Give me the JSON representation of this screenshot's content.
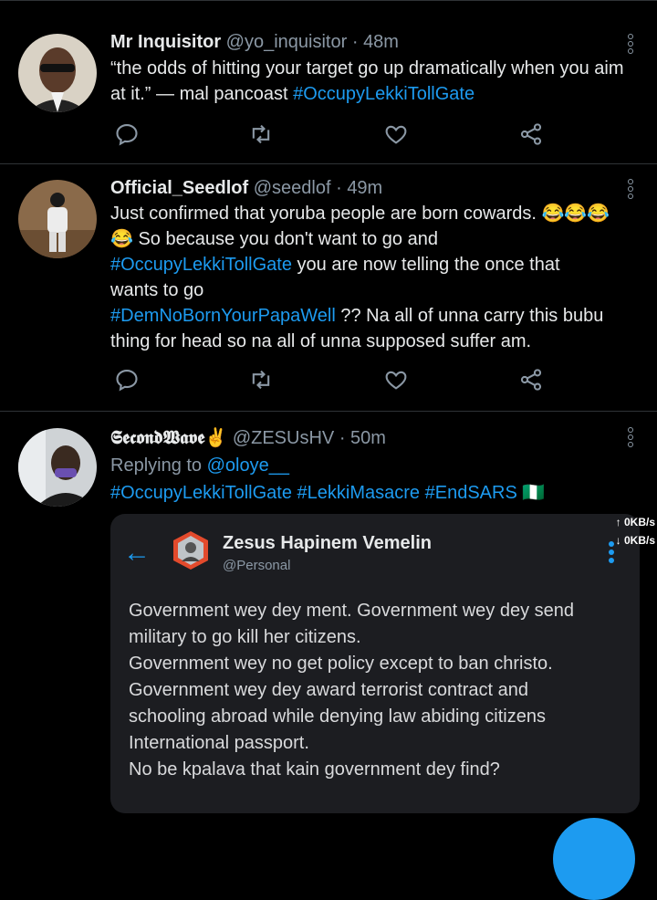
{
  "tweets": [
    {
      "name": "Mr Inquisitor",
      "handle": "@yo_inquisitor",
      "separator": "·",
      "time": "48m",
      "text_parts": [
        "“the odds of hitting your target go up dramatically when you aim at it.” — mal pancoast "
      ],
      "hashtag": "#OccupyLekkiTollGate"
    },
    {
      "name": "Official_Seedlof",
      "handle": "@seedlof",
      "separator": "·",
      "time": "49m",
      "line1": "Just confirmed that yoruba people are born cowards. 😂😂😂",
      "line2": "😂 So because you don't want to go and",
      "hashtag1": "#OccupyLekkiTollGate",
      "line3_rest": " you are now telling the once that",
      "line4": "wants to go",
      "hashtag2": "#DemNoBornYourPapaWell",
      "line5_rest": " ?? Na all of unna carry this bubu",
      "line6": "thing for head so na all of unna supposed suffer am."
    },
    {
      "name": "𝕾𝖊𝖈𝖔𝖓𝖉𝖂𝖆𝖛𝖊✌",
      "handle": "@ZESUsHV",
      "separator": "·",
      "time": "50m",
      "replying_label": "Replying to ",
      "replying_to": "@oloye__",
      "hashtags": [
        "#OccupyLekkiTollGate",
        "#LekkiMasacre",
        "#EndSARS"
      ],
      "hashtag_suffix": "🇳🇬"
    }
  ],
  "quoted": {
    "name": "Zesus Hapinem Vemelin",
    "handle": "@Personal",
    "speed_up": "↑ 0KB/s",
    "speed_down": "↓ 0KB/s",
    "lines": [
      "Government wey dey ment. Government wey dey send",
      "military to go kill her citizens.",
      "Government wey no get policy except to ban christo.",
      "Government wey dey award terrorist contract and",
      "schooling abroad while denying law abiding citizens",
      "International passport.",
      "No be kpalava that kain government dey find?"
    ]
  },
  "colors": {
    "background": "#000000",
    "accent": "#1d9bf0",
    "muted": "#8b98a5",
    "text": "#e7e9ea"
  },
  "icons": [
    "reply-icon",
    "retweet-icon",
    "like-icon",
    "share-icon",
    "more-icon",
    "back-arrow-icon"
  ]
}
